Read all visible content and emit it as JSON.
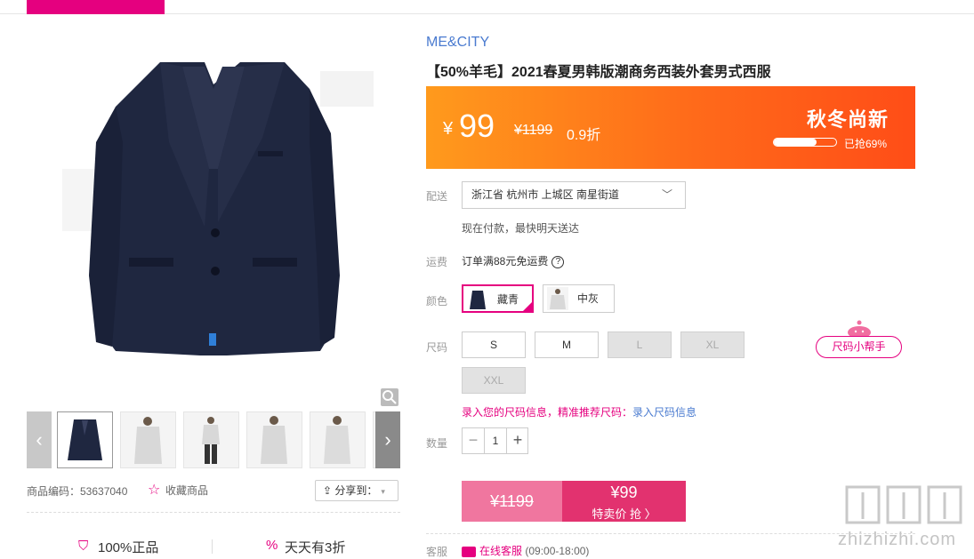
{
  "nav": {
    "category_label": "",
    "items": [
      "",
      "",
      "",
      "",
      "",
      "",
      "",
      "",
      "",
      "",
      "",
      ""
    ]
  },
  "product": {
    "brand": "ME&CITY",
    "title": "【50%羊毛】2021春夏男韩版潮商务西装外套男式西服",
    "code_label": "商品编码：53637040",
    "favorite_label": "收藏商品",
    "share_label": "分享到："
  },
  "price": {
    "currency": "¥",
    "current": "99",
    "original": "¥1199",
    "discount": "0.9折",
    "promo_title": "秋冬尚新",
    "sold_label": "已抢69%",
    "sold_fraction": 0.69
  },
  "delivery": {
    "label": "配送",
    "address": "浙江省 杭州市 上城区 南星街道",
    "note": "现在付款，最快明天送达"
  },
  "shipping": {
    "label": "运费",
    "text": "订单满88元免运费"
  },
  "colors": {
    "label": "颜色",
    "options": [
      {
        "name": "藏青",
        "selected": true
      },
      {
        "name": "中灰",
        "selected": false
      }
    ]
  },
  "sizes": {
    "label": "尺码",
    "options": [
      {
        "name": "S",
        "available": true
      },
      {
        "name": "M",
        "available": true
      },
      {
        "name": "L",
        "available": false
      },
      {
        "name": "XL",
        "available": false
      },
      {
        "name": "XXL",
        "available": false
      }
    ],
    "helper": "尺码小帮手",
    "note_prefix": "录入您的尺码信息，精准推荐尺码：",
    "note_link": "录入尺码信息"
  },
  "quantity": {
    "label": "数量",
    "value": "1",
    "minus": "−",
    "plus": "+"
  },
  "buy": {
    "original": "¥1199",
    "price": "¥99",
    "cta": "特卖价 抢 〉"
  },
  "service": {
    "label": "客服",
    "online": "在线客服",
    "hours": "(09:00-18:00)"
  },
  "badges": {
    "genuine": "100%正品",
    "daily": "天天有3折"
  },
  "watermark": "zhizhizhi.com",
  "colors_theme": {
    "accent": "#e5007f",
    "brand_blue": "#4a7bd0",
    "price_orange": "#ff6a1a"
  }
}
